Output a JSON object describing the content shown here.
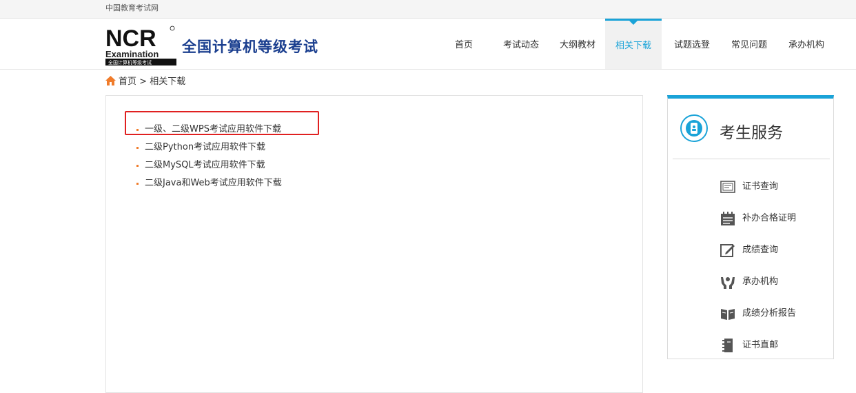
{
  "topbar": {
    "site_name": "中国教育考试网"
  },
  "header": {
    "logo": {
      "main": "NCR",
      "sub": "Examination",
      "band": "全国计算机等级考试",
      "reg": "®"
    },
    "title": "全国计算机等级考试",
    "nav": [
      {
        "label": "首页",
        "active": false
      },
      {
        "label": "考试动态",
        "active": false
      },
      {
        "label": "大纲教材",
        "active": false
      },
      {
        "label": "相关下载",
        "active": true
      },
      {
        "label": "试题选登",
        "active": false
      },
      {
        "label": "常见问题",
        "active": false
      },
      {
        "label": "承办机构",
        "active": false
      }
    ],
    "accent_color": "#1aa3d8"
  },
  "breadcrumb": {
    "home": "首页",
    "separator": ">",
    "current": "相关下载",
    "icon": "home-icon"
  },
  "downloads": [
    {
      "label": "一级、二级WPS考试应用软件下载",
      "highlighted": true
    },
    {
      "label": "二级Python考试应用软件下载",
      "highlighted": false
    },
    {
      "label": "二级MySQL考试应用软件下载",
      "highlighted": false
    },
    {
      "label": "二级Java和Web考试应用软件下载",
      "highlighted": false
    }
  ],
  "sidebar": {
    "title": "考生服务",
    "items": [
      {
        "label": "证书查询",
        "icon": "certificate-search-icon"
      },
      {
        "label": "补办合格证明",
        "icon": "calendar-icon"
      },
      {
        "label": "成绩查询",
        "icon": "edit-icon"
      },
      {
        "label": "承办机构",
        "icon": "hands-icon"
      },
      {
        "label": "成绩分析报告",
        "icon": "book-icon"
      },
      {
        "label": "证书直邮",
        "icon": "notebook-icon"
      }
    ]
  },
  "colors": {
    "bullet": "#f07c2b",
    "highlight_border": "#e02020",
    "title_blue": "#1b3f8f"
  }
}
